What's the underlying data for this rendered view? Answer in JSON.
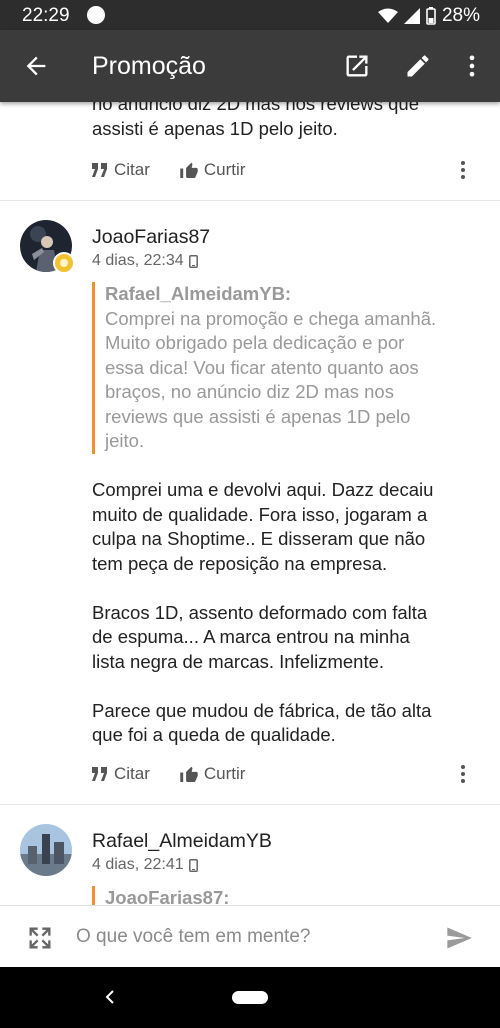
{
  "status_bar": {
    "time": "22:29",
    "battery": "28%"
  },
  "app_bar": {
    "title": "Promoção"
  },
  "post_partial": {
    "lines": [
      "no anúncio diz 2D mas nos reviews que",
      "assisti é apenas 1D pelo jeito."
    ],
    "quote_label": "Citar",
    "like_label": "Curtir"
  },
  "post_joao": {
    "author": "JoaoFarias87",
    "timestamp": "4 dias, 22:34",
    "quote_author": "Rafael_AlmeidamYB:",
    "quote_lines": [
      "Comprei na promoção e chega amanhã.",
      "Muito obrigado pela dedicação e por",
      "essa dica! Vou ficar atento quanto aos",
      "braços, no anúncio diz 2D mas nos",
      "reviews que assisti é apenas 1D pelo",
      "jeito."
    ],
    "body_lines": [
      "Comprei  uma e devolvi aqui. Dazz decaiu",
      "muito de qualidade. Fora isso, jogaram a",
      "culpa na Shoptime.. E disseram que não",
      "tem peça de reposição na empresa.",
      "",
      "Bracos 1D, assento deformado com falta",
      "de espuma... A marca entrou na minha",
      "lista negra de marcas. Infelizmente.",
      "",
      "Parece que mudou de fábrica, de tão alta",
      "que foi a queda de qualidade."
    ],
    "quote_label": "Citar",
    "like_label": "Curtir"
  },
  "post_rafael": {
    "author": "Rafael_AlmeidamYB",
    "timestamp": "4 dias, 22:41",
    "quote_author": "JoaoFarias87:"
  },
  "composer": {
    "placeholder": "O que você tem em mente?"
  }
}
